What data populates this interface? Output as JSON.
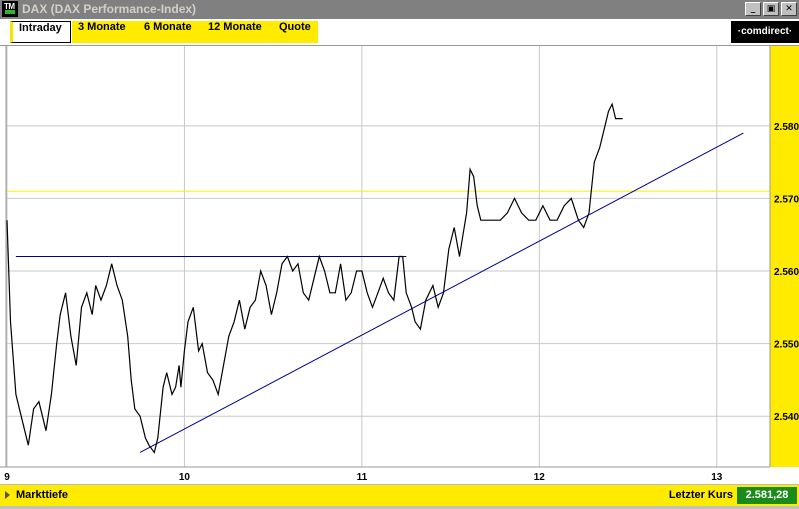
{
  "window": {
    "title": "DAX (DAX Performance-Index)",
    "icon_text": "TM",
    "minimize": "_",
    "restore": "▣",
    "close": "✕"
  },
  "tabs": [
    {
      "label": "Intraday",
      "active": true
    },
    {
      "label": "3 Monate",
      "active": false
    },
    {
      "label": "6 Monate",
      "active": false
    },
    {
      "label": "12 Monate",
      "active": false
    },
    {
      "label": "Quote",
      "active": false
    }
  ],
  "brand": "·comdirect·",
  "status": {
    "left_label": "Markttiefe",
    "right_label": "Letzter Kurs",
    "value": "2.581,28"
  },
  "colors": {
    "accent_yellow": "#ffeb00",
    "price_line": "#000000",
    "trend_line": "#00008b",
    "reference_line": "#f0f000",
    "value_box": "#1a8a1a"
  },
  "chart_data": {
    "type": "line",
    "title": "",
    "x_tick_labels": [
      "9",
      "10",
      "11",
      "12",
      "13"
    ],
    "y_tick_labels": [
      "2.540",
      "2.550",
      "2.560",
      "2.570",
      "2.580"
    ],
    "y_ticks": [
      2540,
      2550,
      2560,
      2570,
      2580
    ],
    "xlim": [
      9,
      13.3
    ],
    "ylim": [
      2533,
      2591
    ],
    "grid": true,
    "series": [
      {
        "x": [
          9.0,
          9.02,
          9.05,
          9.08,
          9.12,
          9.15,
          9.18,
          9.22,
          9.25,
          9.28,
          9.3,
          9.33,
          9.36,
          9.39,
          9.42,
          9.45,
          9.48,
          9.5,
          9.53,
          9.56,
          9.59,
          9.62,
          9.65,
          9.68,
          9.7,
          9.72,
          9.75,
          9.78,
          9.8,
          9.83,
          9.85,
          9.88,
          9.9,
          9.93,
          9.95,
          9.97,
          9.98,
          10.0,
          10.02,
          10.05,
          10.08,
          10.1,
          10.13,
          10.16,
          10.19,
          10.22,
          10.25,
          10.28,
          10.31,
          10.34,
          10.37,
          10.4,
          10.43,
          10.46,
          10.49,
          10.52,
          10.55,
          10.58,
          10.61,
          10.64,
          10.67,
          10.7,
          10.73,
          10.76,
          10.79,
          10.82,
          10.85,
          10.88,
          10.91,
          10.94,
          10.97,
          11.0,
          11.03,
          11.06,
          11.09,
          11.12,
          11.15,
          11.18,
          11.21,
          11.23,
          11.25,
          11.28,
          11.3,
          11.33,
          11.36,
          11.4,
          11.43,
          11.46,
          11.49,
          11.52,
          11.55,
          11.57,
          11.59,
          11.61,
          11.63,
          11.65,
          11.67,
          11.7,
          11.74,
          11.78,
          11.82,
          11.86,
          11.9,
          11.94,
          11.98,
          12.02,
          12.06,
          12.1,
          12.14,
          12.18,
          12.22,
          12.25,
          12.28,
          12.31,
          12.34,
          12.37,
          12.39,
          12.41,
          12.43,
          12.45,
          12.47
        ],
        "y": [
          2567,
          2553,
          2543,
          2540,
          2536,
          2541,
          2542,
          2538,
          2543,
          2550,
          2554,
          2557,
          2551,
          2547,
          2555,
          2557,
          2554,
          2558,
          2556,
          2558,
          2561,
          2558,
          2556,
          2551,
          2545,
          2541,
          2540,
          2537,
          2536,
          2535,
          2537,
          2544,
          2546,
          2543,
          2544,
          2547,
          2544,
          2549,
          2553,
          2555,
          2549,
          2550,
          2546,
          2545,
          2543,
          2547,
          2551,
          2553,
          2556,
          2552,
          2555,
          2556,
          2560,
          2558,
          2554,
          2557,
          2561,
          2562,
          2560,
          2561,
          2557,
          2556,
          2559,
          2562,
          2560,
          2557,
          2557,
          2561,
          2556,
          2557,
          2560,
          2560,
          2557,
          2555,
          2557,
          2559,
          2557,
          2556,
          2562,
          2562,
          2557,
          2555,
          2553,
          2552,
          2556,
          2558,
          2555,
          2557,
          2563,
          2566,
          2562,
          2565,
          2568,
          2574,
          2573,
          2569,
          2567,
          2567,
          2567,
          2567,
          2568,
          2570,
          2568,
          2567,
          2567,
          2569,
          2567,
          2567,
          2569,
          2570,
          2567,
          2566,
          2568,
          2575,
          2577,
          2580,
          2582,
          2583,
          2581,
          2581,
          2581
        ]
      }
    ],
    "trend_lines": [
      {
        "x": [
          9.75,
          13.15
        ],
        "y": [
          2535,
          2579
        ]
      },
      {
        "x": [
          9.05,
          11.25
        ],
        "y": [
          2562,
          2562
        ]
      }
    ],
    "reference_lines": [
      {
        "y": 2571
      }
    ]
  }
}
